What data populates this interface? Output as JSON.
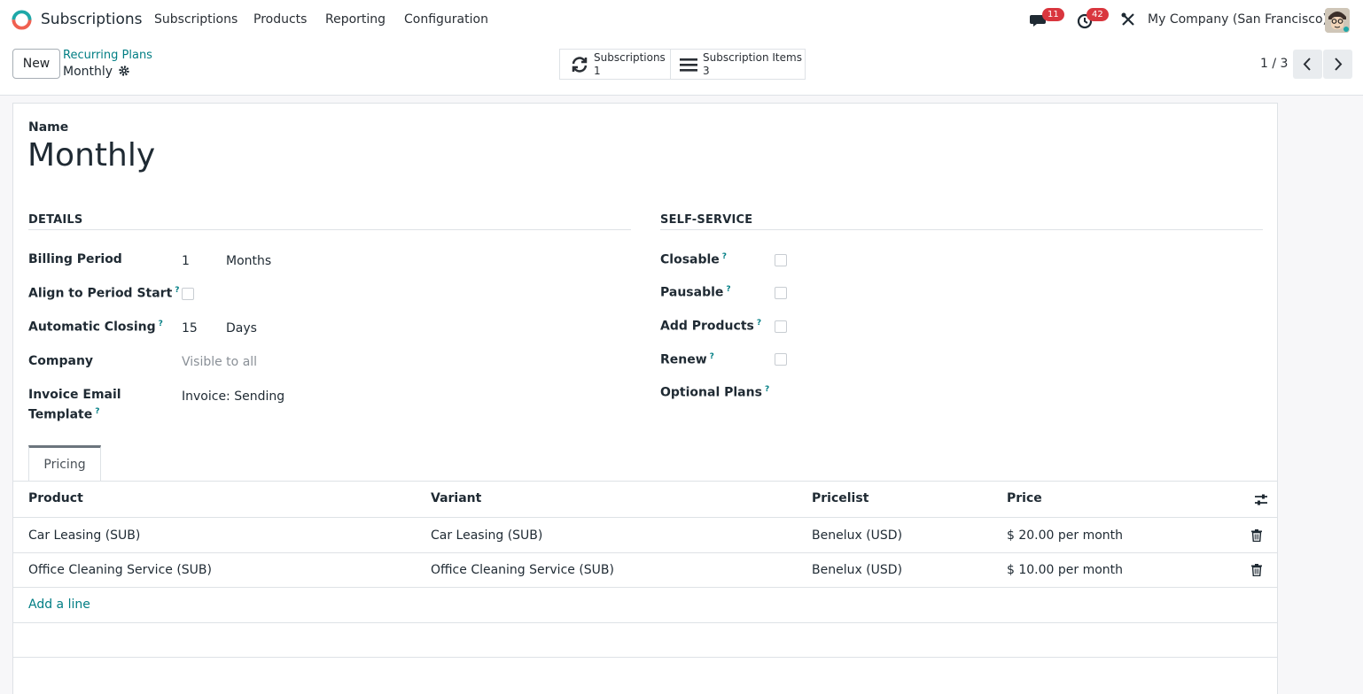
{
  "navbar": {
    "app_name": "Subscriptions",
    "menu": [
      "Subscriptions",
      "Products",
      "Reporting",
      "Configuration"
    ],
    "messages_badge": "11",
    "activities_badge": "42",
    "company": "My Company (San Francisco)"
  },
  "control_panel": {
    "new_label": "New",
    "breadcrumb_parent": "Recurring Plans",
    "breadcrumb_current": "Monthly",
    "smart_buttons": [
      {
        "label": "Subscriptions",
        "value": "1",
        "icon": "refresh-icon"
      },
      {
        "label": "Subscription Items",
        "value": "3",
        "icon": "list-icon"
      }
    ],
    "pager": "1 / 3"
  },
  "form": {
    "name_label": "Name",
    "name_value": "Monthly",
    "details": {
      "title": "DETAILS",
      "billing_period_label": "Billing Period",
      "billing_period_value": "1",
      "billing_period_unit": "Months",
      "align_label": "Align to Period Start",
      "align_checked": false,
      "auto_close_label": "Automatic Closing",
      "auto_close_value": "15",
      "auto_close_unit": "Days",
      "company_label": "Company",
      "company_placeholder": "Visible to all",
      "invoice_template_label_1": "Invoice Email",
      "invoice_template_label_2": "Template",
      "invoice_template_value": "Invoice: Sending"
    },
    "self_service": {
      "title": "SELF-SERVICE",
      "closable_label": "Closable",
      "pausable_label": "Pausable",
      "add_products_label": "Add Products",
      "renew_label": "Renew",
      "optional_plans_label": "Optional Plans"
    },
    "tab_label": "Pricing",
    "table": {
      "headers": [
        "Product",
        "Variant",
        "Pricelist",
        "Price"
      ],
      "rows": [
        {
          "product": "Car Leasing (SUB)",
          "variant": "Car Leasing (SUB)",
          "pricelist": "Benelux (USD)",
          "price": "$ 20.00 per month"
        },
        {
          "product": "Office Cleaning Service (SUB)",
          "variant": "Office Cleaning Service (SUB)",
          "pricelist": "Benelux (USD)",
          "price": "$ 10.00 per month"
        }
      ],
      "add_line": "Add a line"
    }
  },
  "colors": {
    "accent": "#017e84",
    "badge": "#d9363e"
  }
}
